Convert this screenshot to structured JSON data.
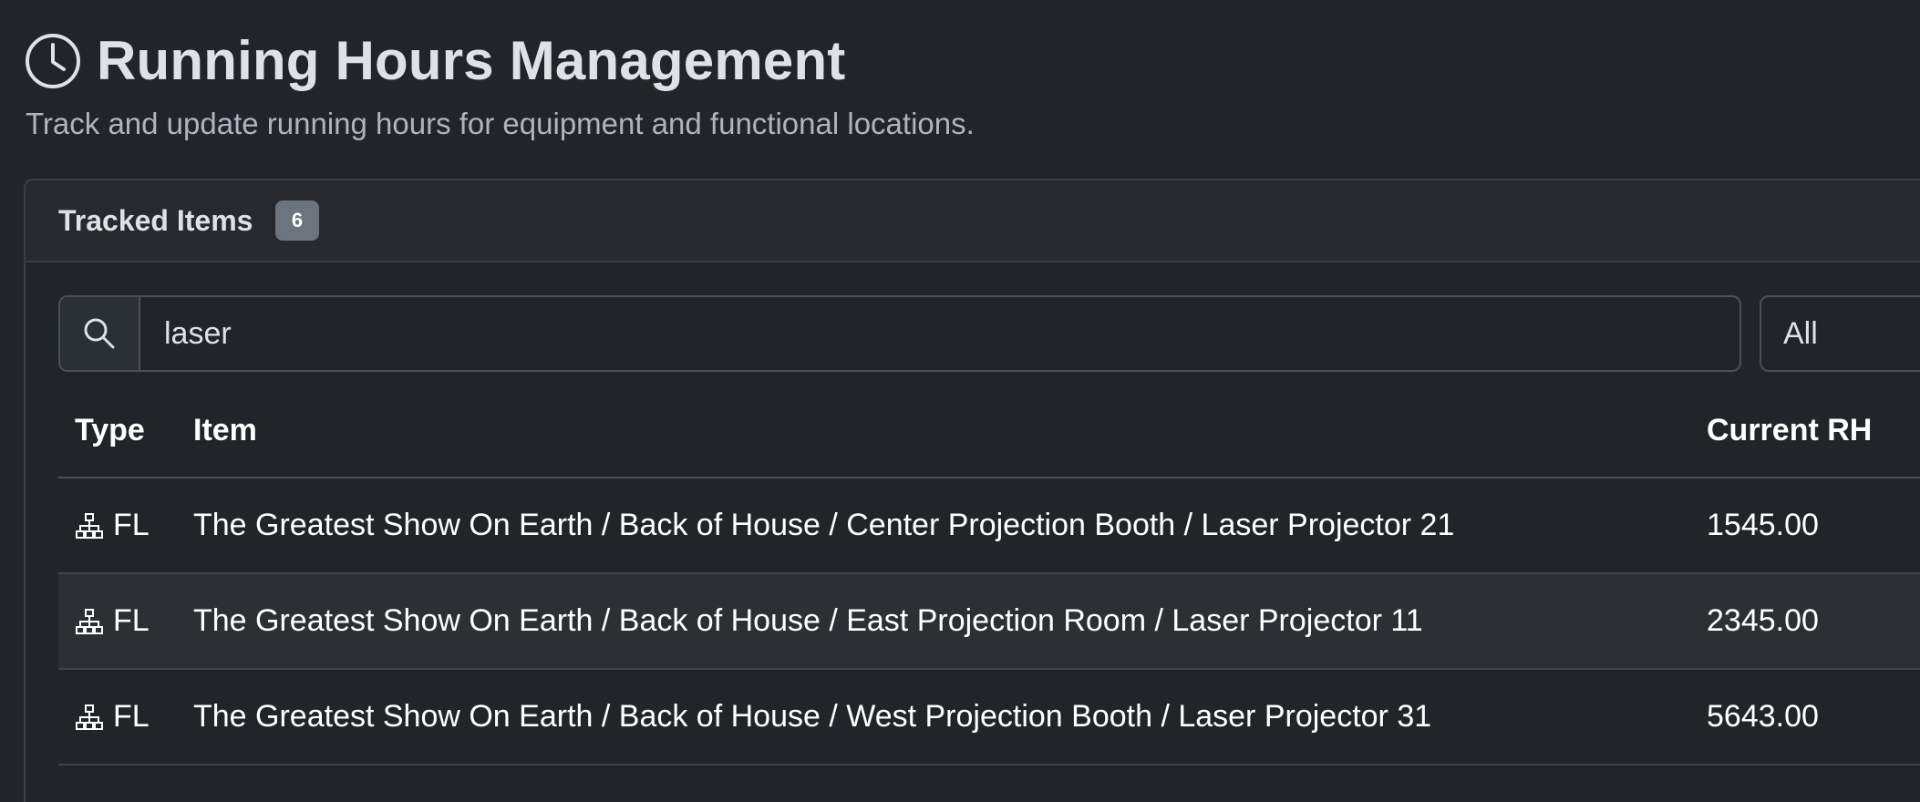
{
  "header": {
    "icon": "clock-icon",
    "title": "Running Hours Management",
    "subtitle": "Track and update running hours for equipment and functional locations."
  },
  "card": {
    "title": "Tracked Items",
    "count": "6"
  },
  "search": {
    "icon": "search-icon",
    "value": "laser",
    "placeholder": ""
  },
  "filter": {
    "selected": "All"
  },
  "table": {
    "columns": [
      "Type",
      "Item",
      "Current RH"
    ],
    "rows": [
      {
        "type_icon": "hierarchy-icon",
        "type": "FL",
        "item": "The Greatest Show On Earth / Back of House / Center Projection Booth / Laser Projector 21",
        "current_rh": "1545.00"
      },
      {
        "type_icon": "hierarchy-icon",
        "type": "FL",
        "item": "The Greatest Show On Earth / Back of House / East Projection Room / Laser Projector 11",
        "current_rh": "2345.00"
      },
      {
        "type_icon": "hierarchy-icon",
        "type": "FL",
        "item": "The Greatest Show On Earth / Back of House / West Projection Booth / Laser Projector 31",
        "current_rh": "5643.00"
      }
    ]
  },
  "colors": {
    "background": "#212529",
    "card_header": "#262a2f",
    "badge": "#6c757d",
    "border": "#495057",
    "text": "#dee2e6",
    "muted_text": "#adb5bd",
    "striped_row": "#2c3034"
  }
}
